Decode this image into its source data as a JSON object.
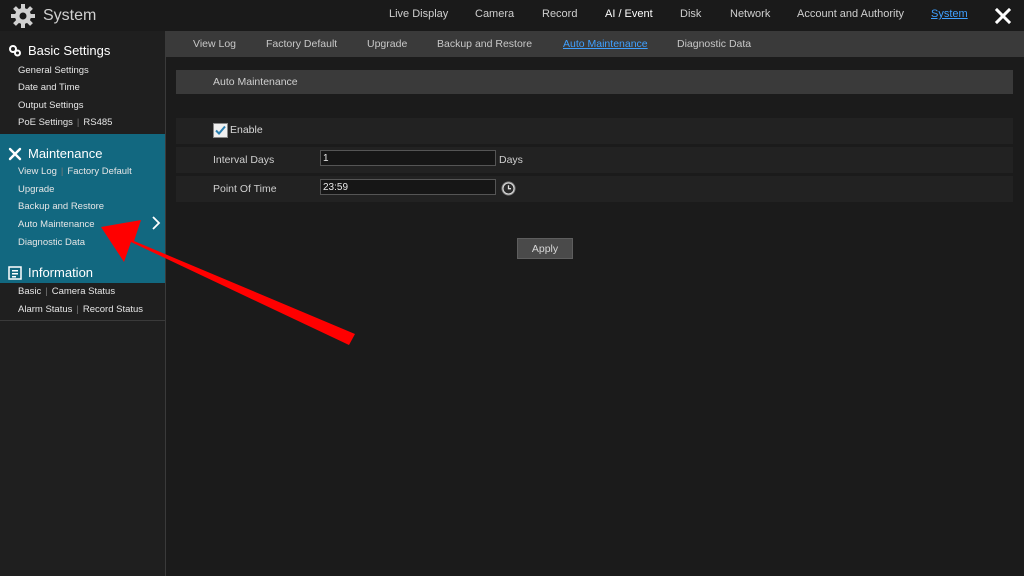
{
  "app": {
    "title": "System"
  },
  "topnav": [
    "Live Display",
    "Camera",
    "Record",
    "AI / Event",
    "Disk",
    "Network",
    "Account and Authority",
    "System"
  ],
  "sidebar": {
    "basic": {
      "title": "Basic Settings",
      "items": [
        "General Settings",
        "Date and Time",
        "Output Settings"
      ],
      "poe": "PoE Settings",
      "rs485": "RS485"
    },
    "maintenance": {
      "title": "Maintenance",
      "view_log": "View Log",
      "factory_default": "Factory Default",
      "upgrade": "Upgrade",
      "backup_restore": "Backup and Restore",
      "auto_maintenance": "Auto Maintenance",
      "diagnostic": "Diagnostic Data"
    },
    "information": {
      "title": "Information",
      "basic": "Basic",
      "camera_status": "Camera Status",
      "alarm_status": "Alarm Status",
      "record_status": "Record Status"
    }
  },
  "subtabs": [
    "View Log",
    "Factory Default",
    "Upgrade",
    "Backup and Restore",
    "Auto Maintenance",
    "Diagnostic Data"
  ],
  "content": {
    "header": "Auto Maintenance",
    "enable_label": "Enable",
    "enable_checked": true,
    "interval_label": "Interval Days",
    "interval_value": "1",
    "interval_unit": "Days",
    "time_label": "Point Of Time",
    "time_value": "23:59",
    "apply": "Apply"
  },
  "colors": {
    "accent": "#3fa0ff",
    "sidebar_active": "#126880",
    "arrow": "#ff0000"
  }
}
